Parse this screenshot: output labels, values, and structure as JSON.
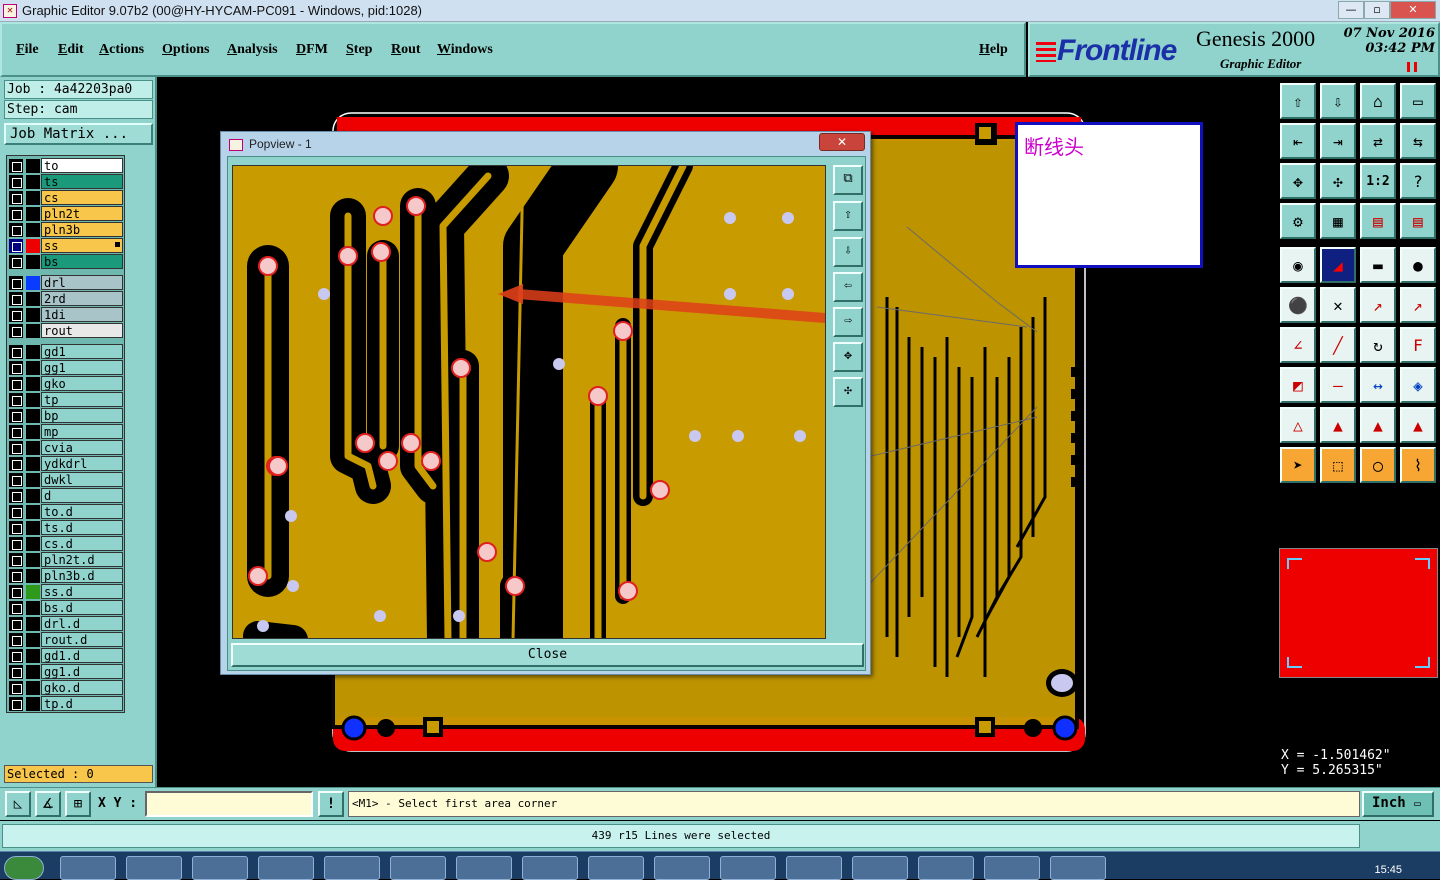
{
  "window": {
    "title": "Graphic Editor 9.07b2 (00@HY-HYCAM-PC091 - Windows, pid:1028)",
    "controls": [
      "—",
      "▫",
      "✕"
    ]
  },
  "menubar": {
    "items": [
      "File",
      "Edit",
      "Actions",
      "Options",
      "Analysis",
      "DFM",
      "Step",
      "Rout",
      "Windows"
    ],
    "help": "Help"
  },
  "brand": {
    "logo": "Frontline",
    "product": "Genesis 2000",
    "subtitle": "Graphic Editor",
    "date": "07 Nov 2016",
    "time": "03:42 PM"
  },
  "job": {
    "job_label": "Job : 4a42203pa0",
    "step_label": "Step: cam",
    "matrix_button": "Job Matrix ..."
  },
  "layers": [
    {
      "name": "to",
      "color": "#ffffff",
      "swatch": "#000000"
    },
    {
      "name": "ts",
      "color": "#1a9a7a",
      "swatch": "#000000"
    },
    {
      "name": "cs",
      "color": "#f7c64a",
      "swatch": "#000000"
    },
    {
      "name": "pln2t",
      "color": "#f7c64a",
      "swatch": "#000000"
    },
    {
      "name": "pln3b",
      "color": "#f7c64a",
      "swatch": "#000000"
    },
    {
      "name": "ss",
      "color": "#f7c64a",
      "swatch": "#ee0000",
      "active": true
    },
    {
      "name": "bs",
      "color": "#1a9a7a",
      "swatch": "#000000"
    },
    {
      "name": "drl",
      "color": "#a8c4c8",
      "swatch": "#0a3cff"
    },
    {
      "name": "2rd",
      "color": "#a8c4c8",
      "swatch": "#000000"
    },
    {
      "name": "1di",
      "color": "#a8c4c8",
      "swatch": "#000000"
    },
    {
      "name": "rout",
      "color": "#e8e8e8",
      "swatch": "#000000"
    },
    {
      "name": "gd1",
      "color": "#8fd3cc",
      "swatch": "#000000"
    },
    {
      "name": "gg1",
      "color": "#8fd3cc",
      "swatch": "#000000"
    },
    {
      "name": "gko",
      "color": "#8fd3cc",
      "swatch": "#000000"
    },
    {
      "name": "tp",
      "color": "#8fd3cc",
      "swatch": "#000000"
    },
    {
      "name": "bp",
      "color": "#8fd3cc",
      "swatch": "#000000"
    },
    {
      "name": "mp",
      "color": "#8fd3cc",
      "swatch": "#000000"
    },
    {
      "name": "cvia",
      "color": "#8fd3cc",
      "swatch": "#000000"
    },
    {
      "name": "ydkdrl",
      "color": "#8fd3cc",
      "swatch": "#000000"
    },
    {
      "name": "dwkl",
      "color": "#8fd3cc",
      "swatch": "#000000"
    },
    {
      "name": "d",
      "color": "#8fd3cc",
      "swatch": "#000000"
    },
    {
      "name": "to.d",
      "color": "#8fd3cc",
      "swatch": "#000000"
    },
    {
      "name": "ts.d",
      "color": "#8fd3cc",
      "swatch": "#000000"
    },
    {
      "name": "cs.d",
      "color": "#8fd3cc",
      "swatch": "#000000"
    },
    {
      "name": "pln2t.d",
      "color": "#8fd3cc",
      "swatch": "#000000"
    },
    {
      "name": "pln3b.d",
      "color": "#8fd3cc",
      "swatch": "#000000"
    },
    {
      "name": "ss.d",
      "color": "#8fd3cc",
      "swatch": "#2f9a1a"
    },
    {
      "name": "bs.d",
      "color": "#8fd3cc",
      "swatch": "#000000"
    },
    {
      "name": "drl.d",
      "color": "#8fd3cc",
      "swatch": "#000000"
    },
    {
      "name": "rout.d",
      "color": "#8fd3cc",
      "swatch": "#000000"
    },
    {
      "name": "gd1.d",
      "color": "#8fd3cc",
      "swatch": "#000000"
    },
    {
      "name": "gg1.d",
      "color": "#8fd3cc",
      "swatch": "#000000"
    },
    {
      "name": "gko.d",
      "color": "#8fd3cc",
      "swatch": "#000000"
    },
    {
      "name": "tp.d",
      "color": "#8fd3cc",
      "swatch": "#000000"
    }
  ],
  "selected": "Selected : 0",
  "popview": {
    "title": "Popview - 1",
    "close_x": "✕",
    "close_button": "Close"
  },
  "note": "断线头",
  "coords": {
    "x": "X = -1.501462\"",
    "y": "Y = 5.265315\""
  },
  "status": {
    "xy_label": "X Y :",
    "xy_value": "",
    "prompt": "<M1> - Select first area corner",
    "unit": "Inch",
    "message": "439 r15 Lines were selected"
  },
  "taskbar": {
    "clock": "15:45"
  },
  "colors": {
    "panel": "#8fd3cc",
    "board_copper": "#c89b00",
    "board_red": "#ee0000",
    "pad": "#c8c8f0"
  }
}
